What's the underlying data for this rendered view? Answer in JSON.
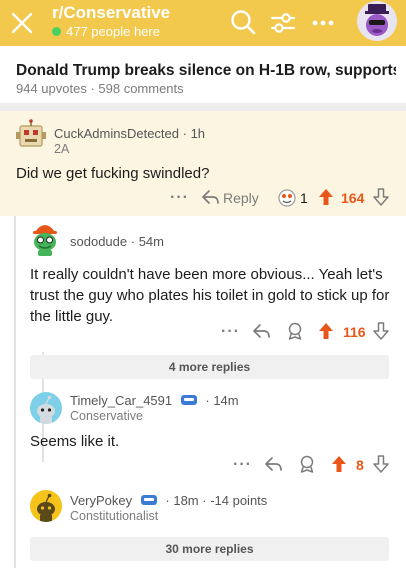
{
  "colors": {
    "header": "#f2c94c",
    "upvote": "#e8561a",
    "highlight": "#fbf5e1"
  },
  "header": {
    "subreddit": "r/Conservative",
    "online": "477 people here",
    "icons": [
      "close-icon",
      "search-icon",
      "filter-icon",
      "more-icon",
      "avatar-icon"
    ]
  },
  "post": {
    "title": "Donald Trump breaks silence on H-1B row, supports...",
    "meta": "944 upvotes · 598 comments"
  },
  "comments": [
    {
      "user": "CuckAdminsDetected",
      "time": "· 1h",
      "flair": "2A",
      "body": "Did we get fucking swindled?",
      "actions": {
        "more": "···",
        "reply": "Reply",
        "award_count": "1",
        "votes": "164"
      }
    },
    {
      "user": "sododude",
      "time": "· 54m",
      "body": "It really couldn't have been more obvious... Yeah let's trust the guy who plates his toilet in gold to stick up for the little guy.",
      "actions": {
        "more": "···",
        "votes": "116"
      },
      "more_replies": "4 more replies"
    },
    {
      "user": "Timely_Car_4591",
      "time": "· 14m",
      "flair": "Conservative",
      "body": "Seems like it.",
      "actions": {
        "more": "···",
        "votes": "8"
      }
    },
    {
      "user": "VeryPokey",
      "time": "· 18m · -14 points",
      "flair": "Constitutionalist",
      "more_replies": "30 more replies"
    }
  ]
}
